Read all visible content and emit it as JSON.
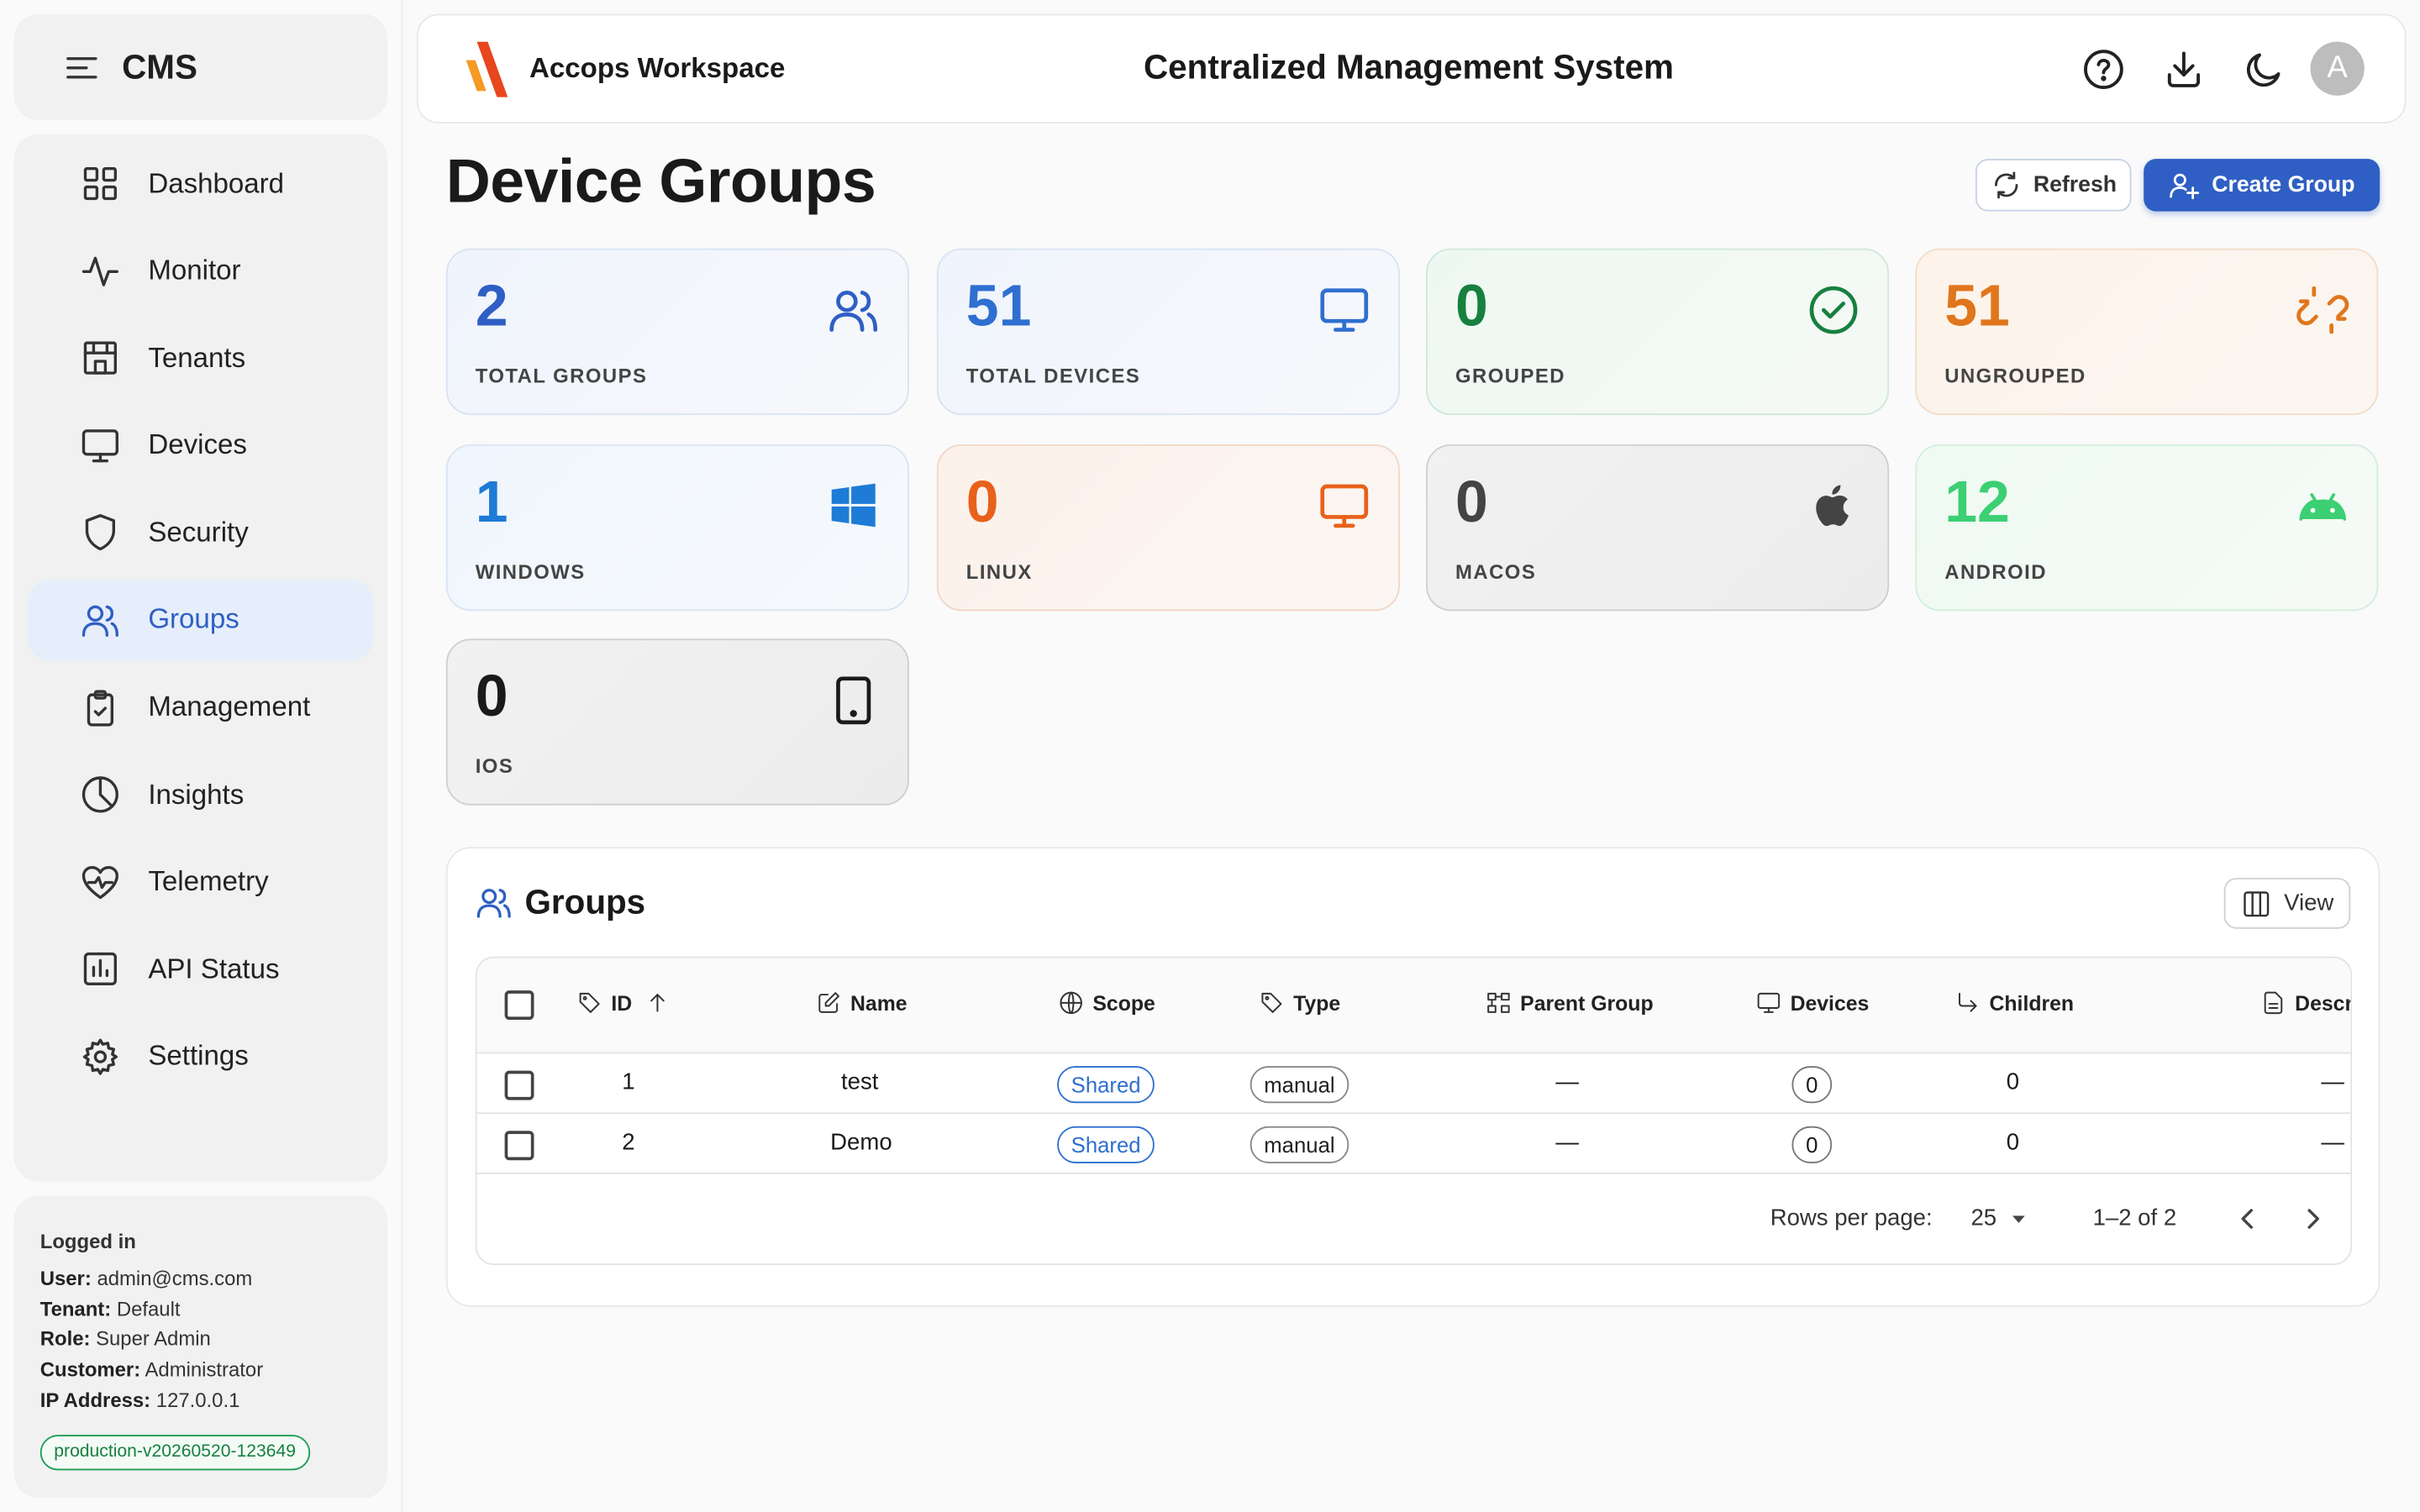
{
  "sidebar": {
    "brand": "CMS",
    "items": [
      {
        "label": "Dashboard",
        "icon": "grid-icon"
      },
      {
        "label": "Monitor",
        "icon": "activity-icon"
      },
      {
        "label": "Tenants",
        "icon": "building-icon"
      },
      {
        "label": "Devices",
        "icon": "monitor-icon"
      },
      {
        "label": "Security",
        "icon": "shield-icon"
      },
      {
        "label": "Groups",
        "icon": "users-icon",
        "active": true
      },
      {
        "label": "Management",
        "icon": "clipboard-check-icon"
      },
      {
        "label": "Insights",
        "icon": "pie-chart-icon"
      },
      {
        "label": "Telemetry",
        "icon": "heart-pulse-icon"
      },
      {
        "label": "API Status",
        "icon": "bar-chart-icon"
      },
      {
        "label": "Settings",
        "icon": "gear-icon"
      }
    ],
    "info": {
      "logged_in": "Logged in",
      "user_label": "User:",
      "user": "admin@cms.com",
      "tenant_label": "Tenant:",
      "tenant": "Default",
      "role_label": "Role:",
      "role": "Super Admin",
      "customer_label": "Customer:",
      "customer": "Administrator",
      "ip_label": "IP Address:",
      "ip": "127.0.0.1",
      "version": "production-v20260520-123649"
    }
  },
  "topbar": {
    "workspace": "Accops Workspace",
    "system_title": "Centralized Management System",
    "avatar_letter": "A"
  },
  "page": {
    "title": "Device Groups",
    "refresh_label": "Refresh",
    "create_label": "Create Group"
  },
  "stats": {
    "total_groups": {
      "value": "2",
      "label": "TOTAL GROUPS",
      "color": "#2f5fc4"
    },
    "total_devices": {
      "value": "51",
      "label": "TOTAL DEVICES",
      "color": "#2f6fd0"
    },
    "grouped": {
      "value": "0",
      "label": "GROUPED",
      "color": "#17803f"
    },
    "ungrouped": {
      "value": "51",
      "label": "UNGROUPED",
      "color": "#e0761b"
    },
    "windows": {
      "value": "1",
      "label": "WINDOWS",
      "color": "#1e7bd6"
    },
    "linux": {
      "value": "0",
      "label": "LINUX",
      "color": "#e8611a"
    },
    "macos": {
      "value": "0",
      "label": "MACOS",
      "color": "#444444"
    },
    "android": {
      "value": "12",
      "label": "ANDROID",
      "color": "#3ccf74"
    },
    "ios": {
      "value": "0",
      "label": "IOS",
      "color": "#1a1a1a"
    }
  },
  "groups": {
    "title": "Groups",
    "view_label": "View",
    "columns": {
      "id": "ID",
      "name": "Name",
      "scope": "Scope",
      "type": "Type",
      "parent": "Parent Group",
      "devices": "Devices",
      "children": "Children",
      "description": "Descr"
    },
    "rows": [
      {
        "id": "1",
        "name": "test",
        "scope": "Shared",
        "type": "manual",
        "parent": "—",
        "devices": "0",
        "children": "0",
        "description": "—"
      },
      {
        "id": "2",
        "name": "Demo",
        "scope": "Shared",
        "type": "manual",
        "parent": "—",
        "devices": "0",
        "children": "0",
        "description": "—"
      }
    ],
    "pagination": {
      "rows_per_page_label": "Rows per page:",
      "rows_per_page": "25",
      "range": "1–2 of 2"
    }
  }
}
